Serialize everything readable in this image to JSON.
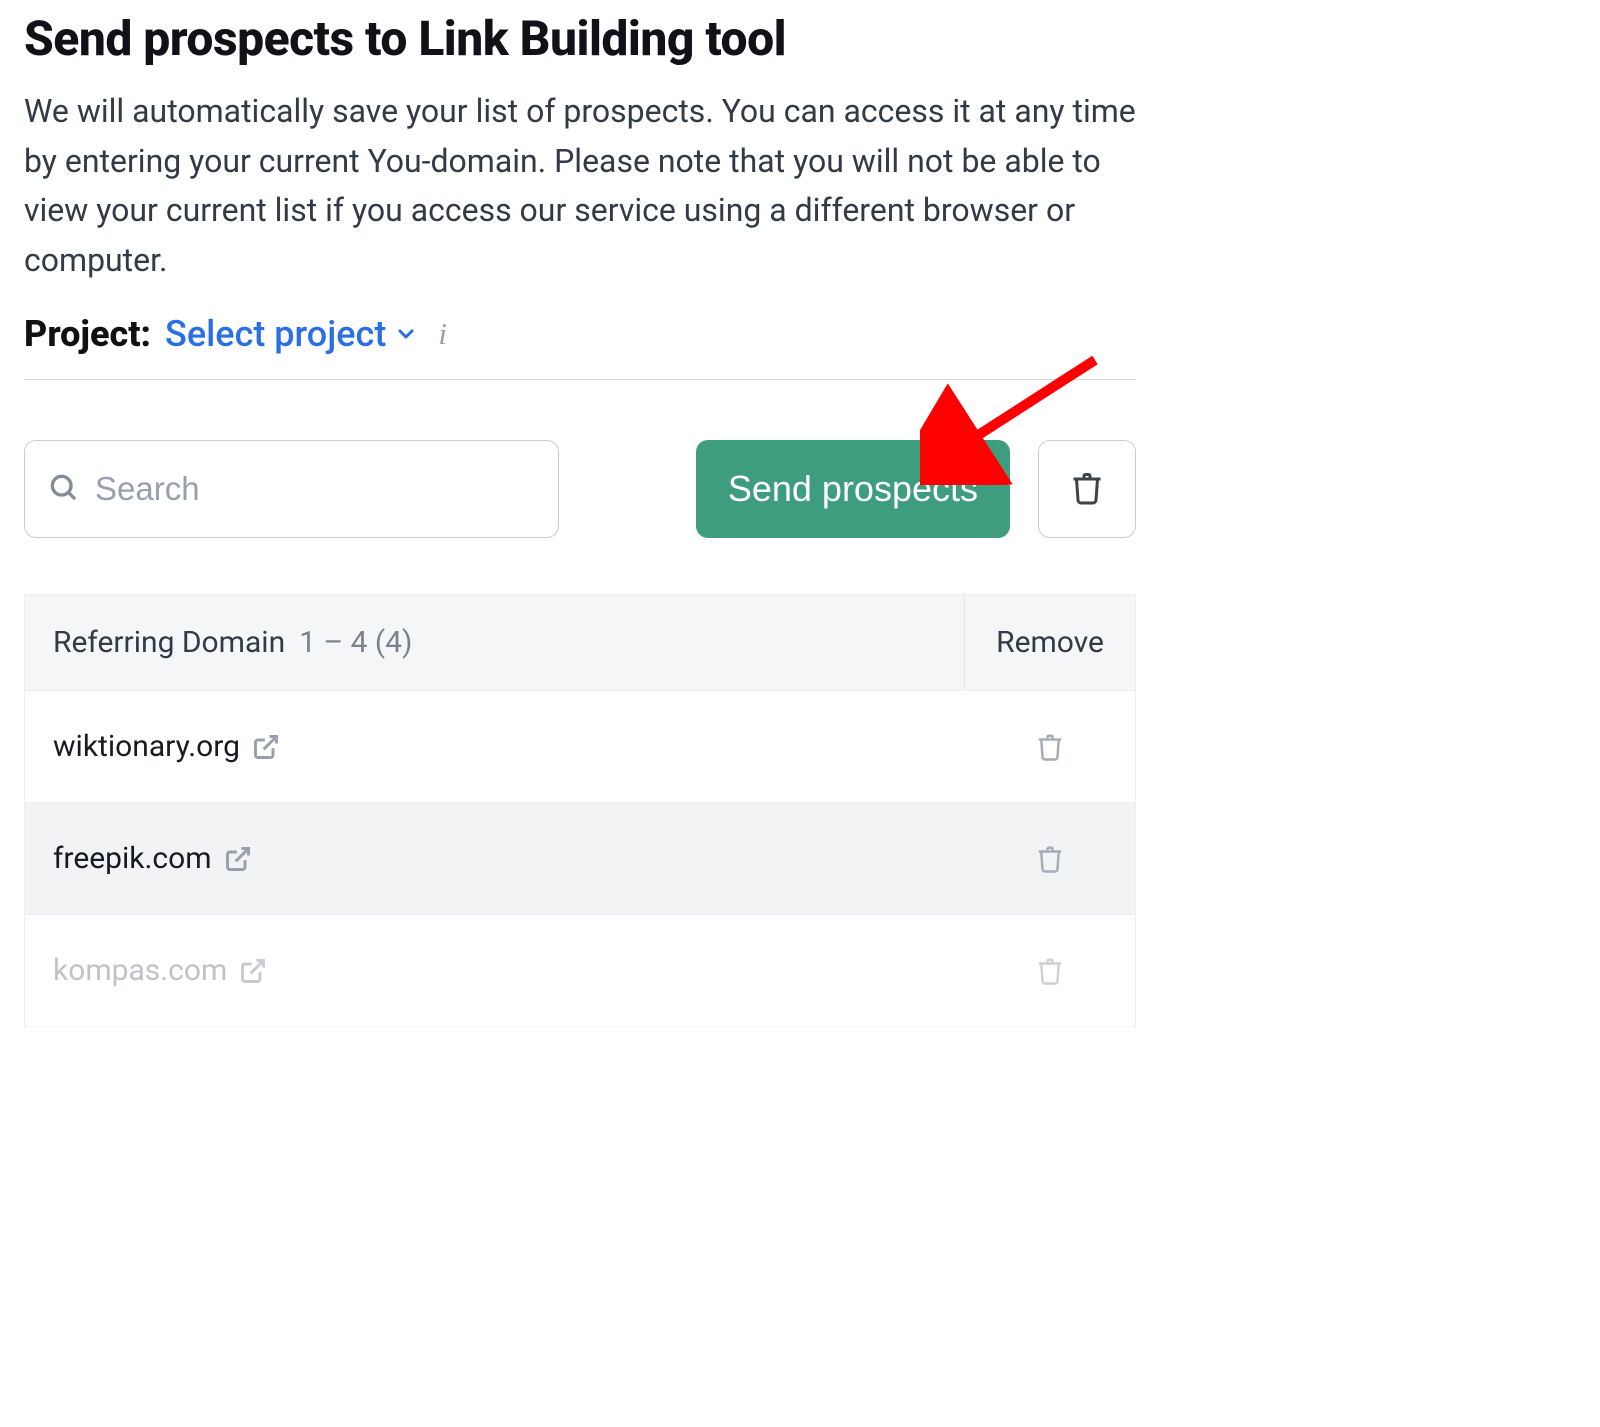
{
  "title": "Send prospects to Link Building tool",
  "description": "We will automatically save your list of prospects. You can access it at any time by entering your current You-domain. Please note that you will not be able to view your current list if you access our service using a different browser or computer.",
  "project": {
    "label": "Project:",
    "select_text": "Select project"
  },
  "toolbar": {
    "search_placeholder": "Search",
    "send_button": "Send prospects"
  },
  "table": {
    "header_domain": "Referring Domain",
    "header_range": "1 – 4 (4)",
    "header_remove": "Remove",
    "rows": [
      {
        "domain": "wiktionary.org"
      },
      {
        "domain": "freepik.com"
      },
      {
        "domain": "kompas.com"
      }
    ]
  }
}
